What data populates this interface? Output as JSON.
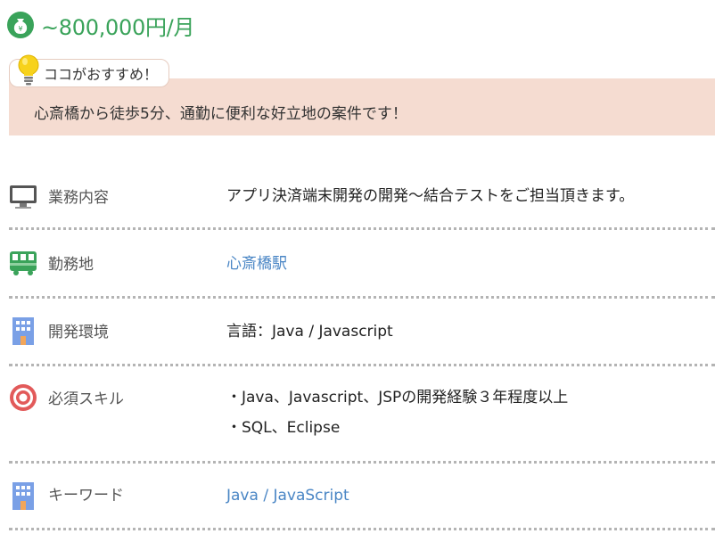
{
  "salary": {
    "text": "~800,000円/月",
    "icon": "money-bag-icon",
    "color": "#3aa35a"
  },
  "recommend": {
    "tag_label": "ココがおすすめ！",
    "text": "心斎橋から徒歩5分、通勤に便利な好立地の案件です！",
    "icon": "lightbulb-icon",
    "bg_color": "#f5dcd1"
  },
  "rows": [
    {
      "icon": "monitor-icon",
      "label": "業務内容",
      "lines": [
        "アプリ決済端末開発の開発～結合テストをご担当頂きます。"
      ]
    },
    {
      "icon": "train-icon",
      "label": "勤務地",
      "link": "心斎橋駅"
    },
    {
      "icon": "building-icon",
      "label": "開発環境",
      "lines": [
        "言語：Java / Javascript"
      ]
    },
    {
      "icon": "target-icon",
      "label": "必須スキル",
      "lines": [
        "・Java、Javascript、JSPの開発経験３年程度以上",
        "・SQL、Eclipse"
      ]
    },
    {
      "icon": "building-icon",
      "label": "キーワード",
      "keywords": [
        "Java",
        "JavaScript"
      ],
      "separator": " / "
    }
  ],
  "colors": {
    "link": "#4a86c5",
    "divider": "#b4b4b4"
  }
}
